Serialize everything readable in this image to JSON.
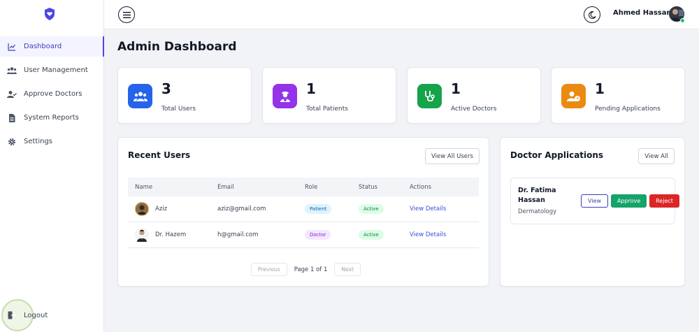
{
  "app": {
    "logo_icon": "heart-shield-icon",
    "brand_color": "#4f46e5"
  },
  "sidebar": {
    "items": [
      {
        "label": "Dashboard",
        "icon": "chart-line-icon",
        "active": true
      },
      {
        "label": "User Management",
        "icon": "users-icon",
        "active": false
      },
      {
        "label": "Approve Doctors",
        "icon": "user-check-icon",
        "active": false
      },
      {
        "label": "System Reports",
        "icon": "file-report-icon",
        "active": false
      },
      {
        "label": "Settings",
        "icon": "gear-icon",
        "active": false
      }
    ],
    "logout_label": "Logout"
  },
  "topbar": {
    "menu_icon": "hamburger-menu-icon",
    "theme_icon": "moon-icon",
    "user_name": "Ahmed Hassan"
  },
  "main": {
    "title": "Admin Dashboard",
    "stats": [
      {
        "value": "3",
        "label": "Total Users",
        "color": "#2563eb",
        "icon": "users-icon"
      },
      {
        "value": "1",
        "label": "Total Patients",
        "color": "#9333ea",
        "icon": "patient-icon"
      },
      {
        "value": "1",
        "label": "Active Doctors",
        "color": "#16a34a",
        "icon": "stethoscope-icon"
      },
      {
        "value": "1",
        "label": "Pending Applications",
        "color": "#ea8a10",
        "icon": "user-clock-icon"
      }
    ],
    "recent_users": {
      "title": "Recent Users",
      "view_all_label": "View All Users",
      "columns": [
        "Name",
        "Email",
        "Role",
        "Status",
        "Actions"
      ],
      "rows": [
        {
          "name": "Aziz",
          "email": "aziz@gmail.com",
          "role": "Patient",
          "status": "Active",
          "action": "View Details"
        },
        {
          "name": "Dr. Hazem",
          "email": "h@gmail.com",
          "role": "Doctor",
          "status": "Active",
          "action": "View Details"
        }
      ],
      "pagination": {
        "prev_label": "Previous",
        "info": "Page 1 of 1",
        "next_label": "Next"
      }
    },
    "doctor_applications": {
      "title": "Doctor Applications",
      "view_all_label": "View All",
      "items": [
        {
          "name": "Dr. Fatima Hassan",
          "specialty": "Dermatology",
          "view_label": "View",
          "approve_label": "Approve",
          "reject_label": "Reject"
        }
      ]
    }
  }
}
